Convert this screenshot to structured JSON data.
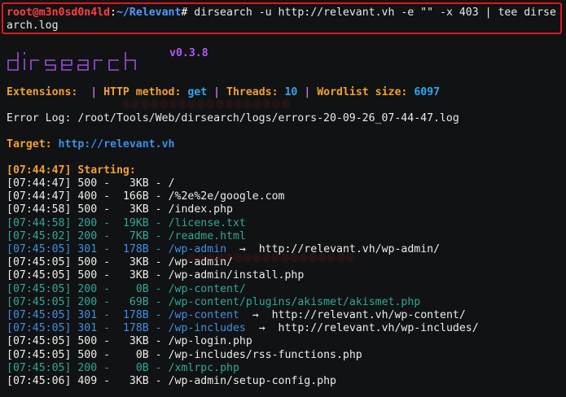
{
  "command": {
    "user": "root@m3n0sd0n4ld",
    "sep": ":",
    "path": "~/Relevant",
    "prompt": "#",
    "cmd_line1": " dirsearch -u http://relevant.vh -e \"\" -x 403 | tee dirse",
    "cmd_line2": "arch.log"
  },
  "banner": {
    "logo_text": "dirsearch",
    "version": "v0.3.8"
  },
  "config": {
    "extensions_label": "Extensions:",
    "extensions_value": "",
    "method_label": "HTTP method:",
    "method_value": "get",
    "threads_label": "Threads:",
    "threads_value": "10",
    "wordlist_label": "Wordlist size:",
    "wordlist_value": "6097"
  },
  "error_log": "Error Log: /root/Tools/Web/dirsearch/logs/errors-20-09-26_07-44-47.log",
  "target": {
    "label": "Target:",
    "value": "http://relevant.vh"
  },
  "starting": "[07:44:47] Starting:",
  "results": [
    {
      "time": "[07:44:47]",
      "code": "500",
      "size": "3KB",
      "path": "/",
      "redirect": ""
    },
    {
      "time": "[07:44:47]",
      "code": "400",
      "size": "166B",
      "path": "/%2e%2e/google.com",
      "redirect": ""
    },
    {
      "time": "[07:44:58]",
      "code": "500",
      "size": "3KB",
      "path": "/index.php",
      "redirect": ""
    },
    {
      "time": "[07:44:58]",
      "code": "200",
      "size": "19KB",
      "path": "/license.txt",
      "redirect": ""
    },
    {
      "time": "[07:45:02]",
      "code": "200",
      "size": "7KB",
      "path": "/readme.html",
      "redirect": ""
    },
    {
      "time": "[07:45:05]",
      "code": "301",
      "size": "178B",
      "path": "/wp-admin",
      "redirect": "http://relevant.vh/wp-admin/"
    },
    {
      "time": "[07:45:05]",
      "code": "500",
      "size": "3KB",
      "path": "/wp-admin/",
      "redirect": ""
    },
    {
      "time": "[07:45:05]",
      "code": "500",
      "size": "3KB",
      "path": "/wp-admin/install.php",
      "redirect": ""
    },
    {
      "time": "[07:45:05]",
      "code": "200",
      "size": "0B",
      "path": "/wp-content/",
      "redirect": ""
    },
    {
      "time": "[07:45:05]",
      "code": "200",
      "size": "69B",
      "path": "/wp-content/plugins/akismet/akismet.php",
      "redirect": ""
    },
    {
      "time": "[07:45:05]",
      "code": "301",
      "size": "178B",
      "path": "/wp-content",
      "redirect": "http://relevant.vh/wp-content/"
    },
    {
      "time": "[07:45:05]",
      "code": "301",
      "size": "178B",
      "path": "/wp-includes",
      "redirect": "http://relevant.vh/wp-includes/"
    },
    {
      "time": "[07:45:05]",
      "code": "500",
      "size": "3KB",
      "path": "/wp-login.php",
      "redirect": ""
    },
    {
      "time": "[07:45:05]",
      "code": "500",
      "size": "0B",
      "path": "/wp-includes/rss-functions.php",
      "redirect": ""
    },
    {
      "time": "[07:45:05]",
      "code": "200",
      "size": "0B",
      "path": "/xmlrpc.php",
      "redirect": ""
    },
    {
      "time": "[07:45:06]",
      "code": "409",
      "size": "3KB",
      "path": "/wp-admin/setup-config.php",
      "redirect": ""
    }
  ],
  "colors": {
    "highlight_border": "#e01820",
    "code_200": "#2fa89a",
    "code_301": "#3f8fe0",
    "code_500": "#ececec"
  }
}
